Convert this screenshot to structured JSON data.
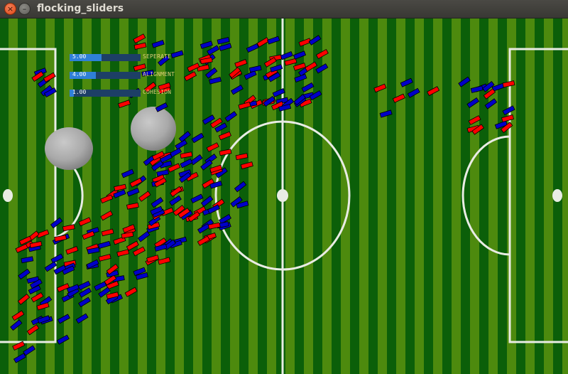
{
  "window": {
    "title": "flocking_sliders",
    "close_glyph": "×",
    "minimize_glyph": "–"
  },
  "colors": {
    "grass_dark": "#0b5f09",
    "grass_light": "#4d8a0e",
    "lines": "#e9ece4",
    "red_boid": "#ff0000",
    "blue_boid": "#0000c8",
    "slider_track": "#1d3f66",
    "slider_fill": "#2f80d8",
    "slider_label": "#e2cf7a"
  },
  "sliders": [
    {
      "value": "5.00",
      "label": "SEPERATE",
      "fraction": 0.45
    },
    {
      "value": "4.00",
      "label": "ALIGNMENT",
      "fraction": 0.37
    },
    {
      "value": "1.00",
      "label": "COHESION",
      "fraction": 0.06
    }
  ]
}
